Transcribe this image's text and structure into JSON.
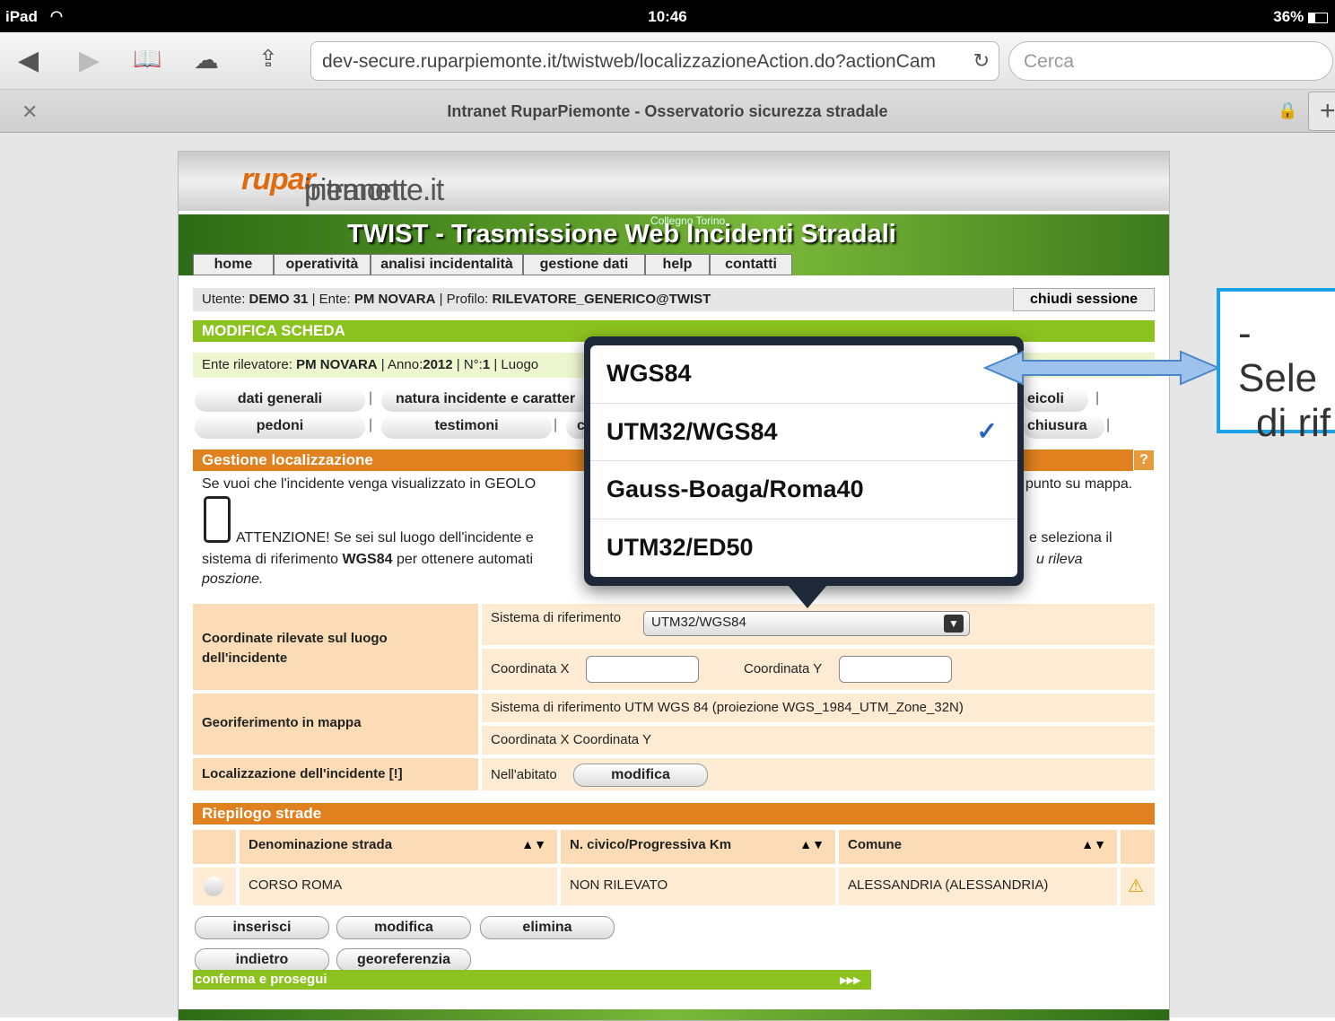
{
  "status": {
    "device": "iPad",
    "time": "10:46",
    "battery": "36%"
  },
  "browser": {
    "url": "dev-secure.ruparpiemonte.it/twistweb/localizzazioneAction.do?actionCam",
    "search_placeholder": "Cerca",
    "tab_title": "Intranet RuparPiemonte - Osservatorio sicurezza stradale"
  },
  "site": {
    "brand_pre": "intranet.",
    "brand_mid": "rupar",
    "brand_post": "piemonte.it",
    "twist_title": "TWIST - Trasmissione Web Incidenti Stradali",
    "map_label": "Collegno Torino",
    "nav": [
      "home",
      "operatività",
      "analisi incidentalità",
      "gestione dati",
      "help",
      "contatti"
    ],
    "user_line": {
      "utente_label": "Utente:",
      "utente": "DEMO 31",
      "ente_label": "| Ente:",
      "ente": "PM NOVARA",
      "profilo_label": "| Profilo:",
      "profilo": "RILEVATORE_GENERICO@TWIST"
    },
    "close_session": "chiudi sessione",
    "section_modifica": "MODIFICA SCHEDA",
    "ente_line": {
      "label": "Ente rilevatore:",
      "ente": "PM NOVARA",
      "anno_label": "| Anno:",
      "anno": "2012",
      "n_label": "| N°:",
      "n": "1",
      "luogo": "| Luogo"
    },
    "tabs_row1": [
      "dati generali",
      "natura incidente e caratter",
      "eicoli"
    ],
    "tabs_row2": [
      "pedoni",
      "testimoni",
      "c",
      "chiusura"
    ],
    "section_gestione": "Gestione localizzazione",
    "help_icon": "?",
    "info1a": "Se vuoi che l'incidente venga visualizzato in GEOLO",
    "info1b": "punto su mappa.",
    "info2a": "ATTENZIONE! Se sei sul luogo dell'incidente e",
    "info2b": "e seleziona il",
    "info3a": "sistema di riferimento",
    "info3b": "WGS84",
    "info3c": "per ottenere automati",
    "info3d": "u rileva",
    "info4": "poszione.",
    "coord_label": "Coordinate rilevate sul luogo dell'incidente",
    "sistema_label": "Sistema di riferimento",
    "sistema_value": "UTM32/WGS84",
    "coord_x_label": "Coordinata X",
    "coord_y_label": "Coordinata Y",
    "geo_label": "Georiferimento in mappa",
    "geo_sistema": "Sistema di riferimento UTM WGS 84 (proiezione WGS_1984_UTM_Zone_32N)",
    "geo_coords": "Coordinata X Coordinata Y",
    "loc_label": "Localizzazione dell'incidente [!]",
    "abitato": "Nell'abitato",
    "modifica_btn": "modifica",
    "section_riepilogo": "Riepilogo strade",
    "table_headers": [
      "Denominazione strada",
      "N. civico/Progressiva Km",
      "Comune"
    ],
    "table_row": [
      "CORSO ROMA",
      "NON RILEVATO",
      "ALESSANDRIA (ALESSANDRIA)"
    ],
    "buttons_row1": [
      "inserisci",
      "modifica",
      "elimina"
    ],
    "buttons_row2": [
      "indietro",
      "georeferenzia"
    ],
    "confirm": "conferma e prosegui",
    "confirm_arrows": "▸▸▸"
  },
  "popover": {
    "options": [
      "WGS84",
      "UTM32/WGS84",
      "Gauss-Boaga/Roma40",
      "UTM32/ED50"
    ],
    "selected": "UTM32/WGS84"
  },
  "callout": {
    "line1": "- Sele",
    "line2": "di rif"
  }
}
